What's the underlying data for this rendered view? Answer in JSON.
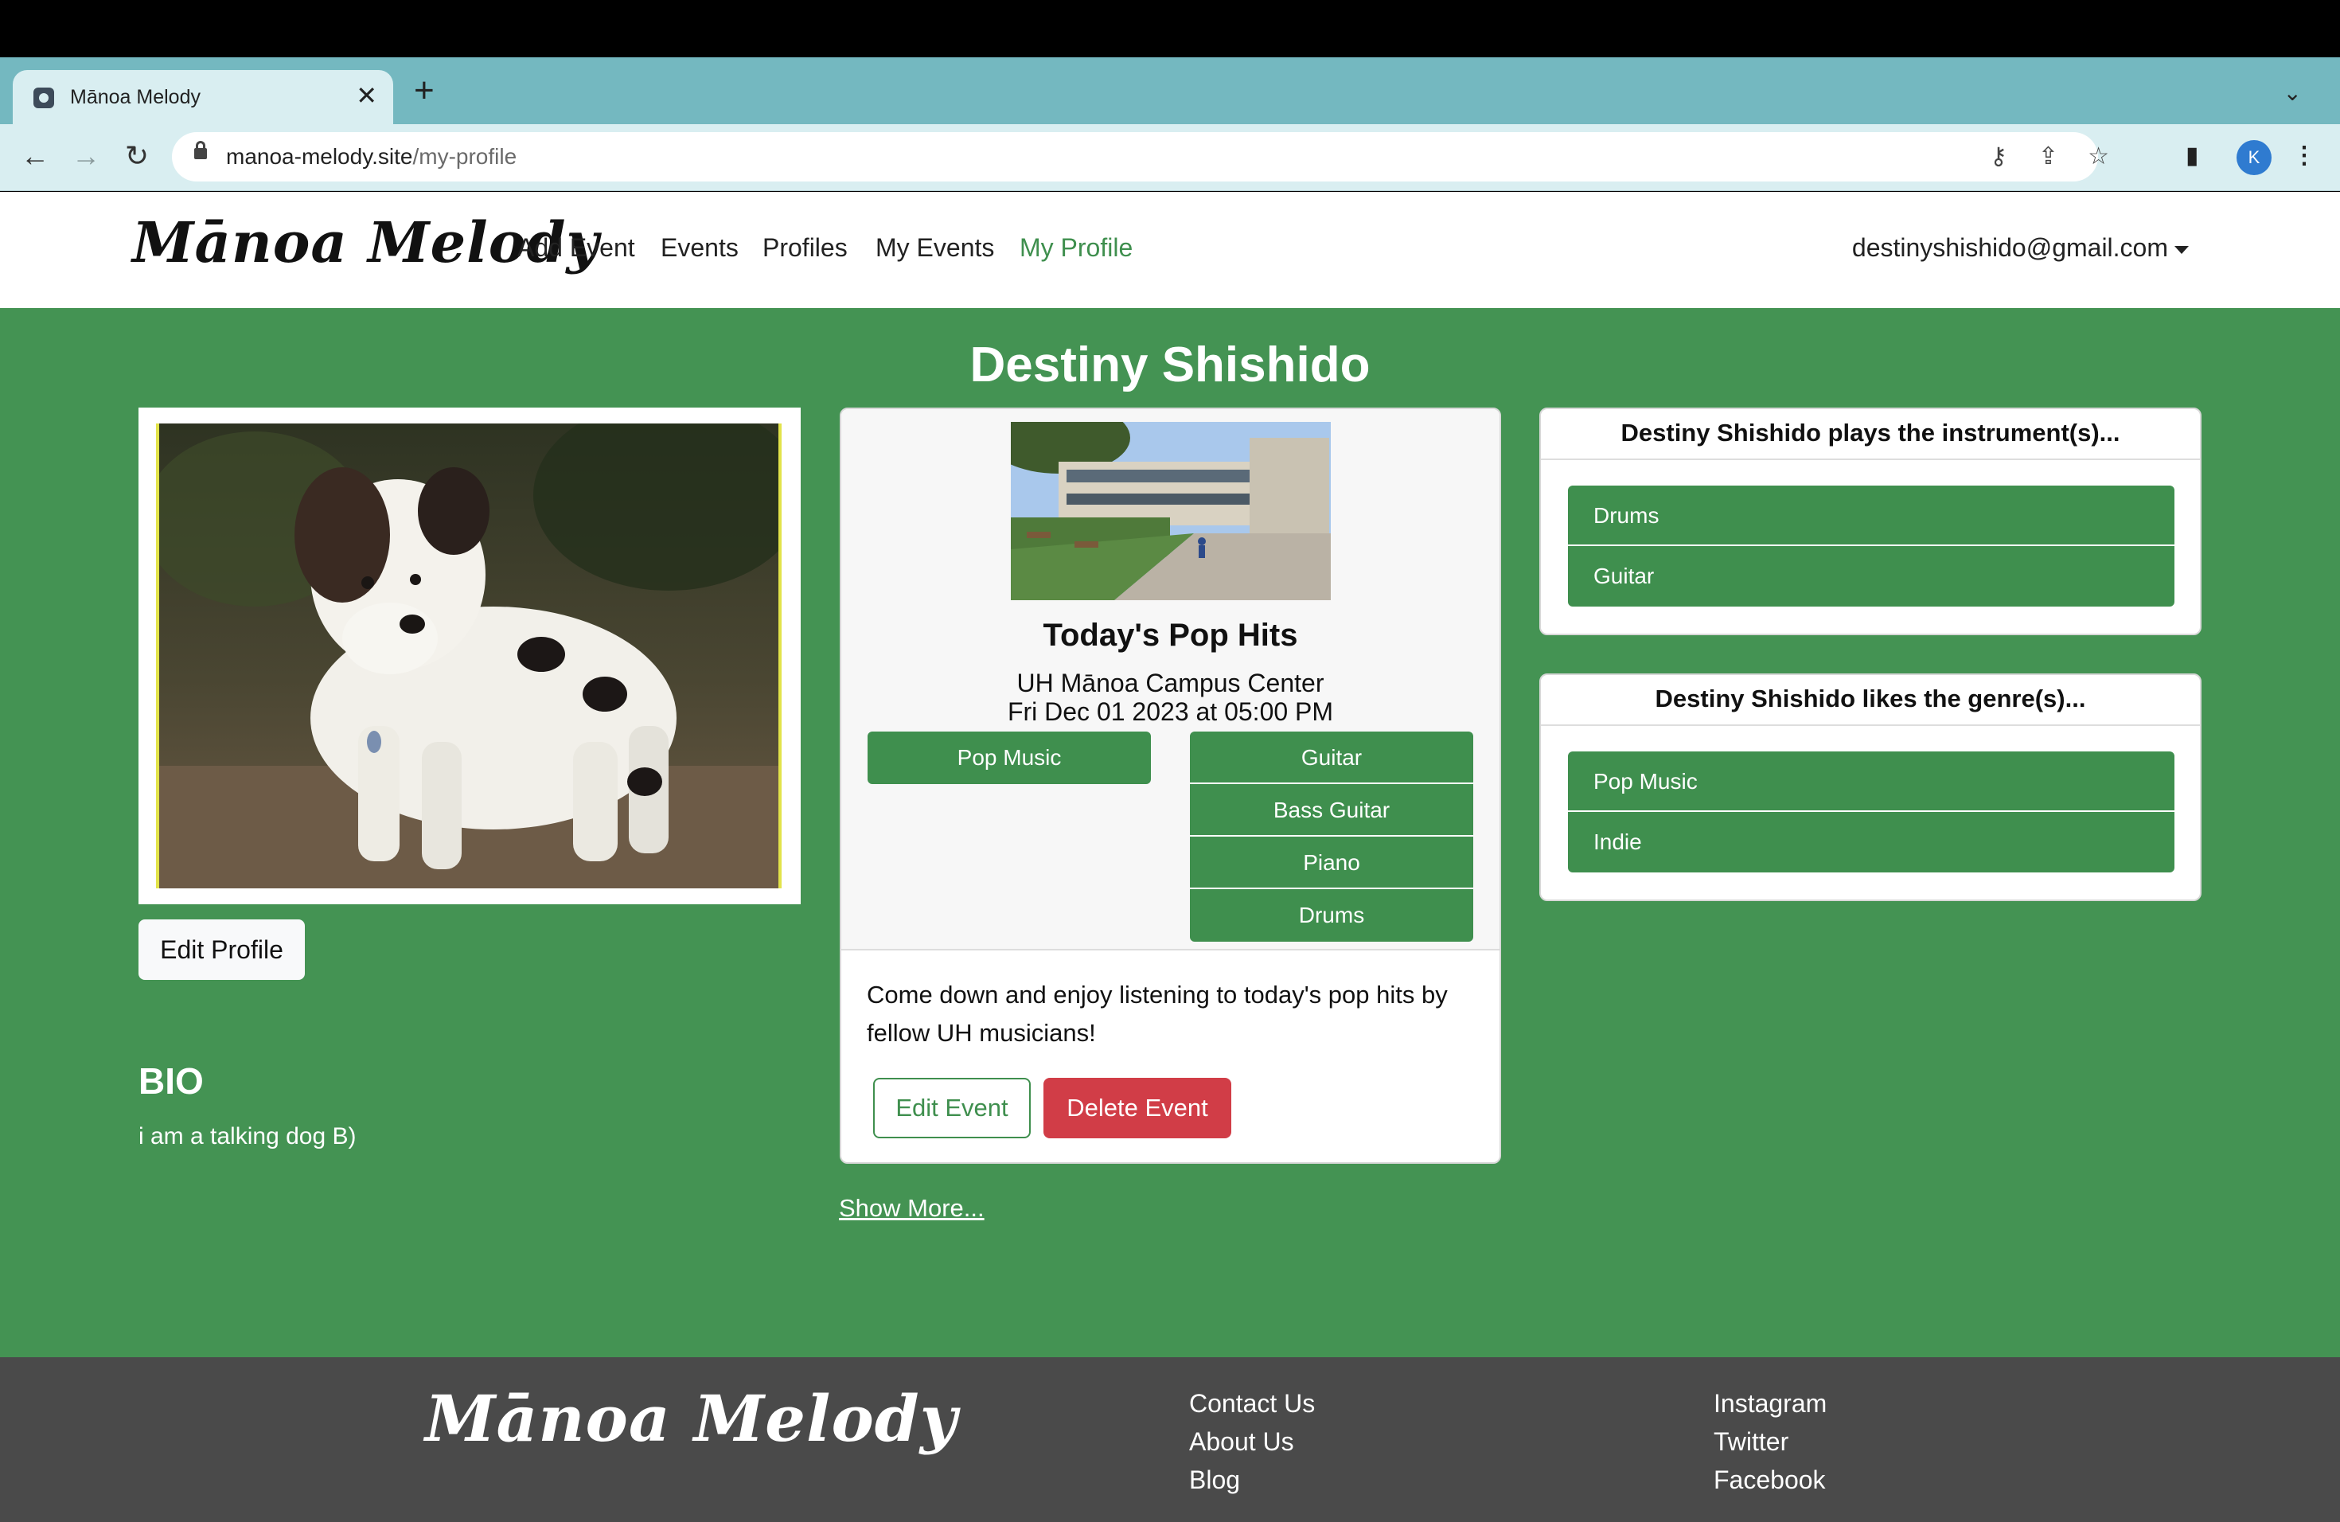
{
  "browser": {
    "tab_title": "Mānoa Melody",
    "tab_close": "✕",
    "new_tab": "+",
    "tab_menu": "⌄",
    "url_host": "manoa-melody.site",
    "url_path": "/my-profile",
    "profile_initial": "K",
    "icons": {
      "back": "←",
      "forward": "→",
      "reload": "↻",
      "key": "⚷",
      "share": "⇪",
      "star": "☆",
      "side_panel": "▮",
      "menu": "⋮"
    }
  },
  "nav": {
    "brand": "Mānoa Melody",
    "links": [
      "Add Event",
      "Events",
      "Profiles",
      "My Events",
      "My Profile"
    ],
    "active": "My Profile",
    "user_email": "destinyshishido@gmail.com"
  },
  "profile": {
    "name": "Destiny Shishido",
    "edit_label": "Edit Profile",
    "bio_title": "BIO",
    "bio": "i am a talking dog B)"
  },
  "event": {
    "title": "Today's Pop Hits",
    "venue": "UH Mānoa Campus Center",
    "date": "Fri Dec 01 2023 at 05:00 PM",
    "genres": [
      "Pop Music"
    ],
    "instruments": [
      "Guitar",
      "Bass Guitar",
      "Piano",
      "Drums"
    ],
    "description": "Come down and enjoy listening to today's pop hits by fellow UH musicians!",
    "edit_label": "Edit Event",
    "delete_label": "Delete Event"
  },
  "show_more": "Show More...",
  "instruments_card": {
    "heading": "Destiny Shishido plays the instrument(s)...",
    "items": [
      "Drums",
      "Guitar"
    ]
  },
  "genres_card": {
    "heading": "Destiny Shishido likes the genre(s)...",
    "items": [
      "Pop Music",
      "Indie"
    ]
  },
  "footer": {
    "brand": "Mānoa Melody",
    "col1": [
      "Contact Us",
      "About Us",
      "Blog"
    ],
    "col2": [
      "Instagram",
      "Twitter",
      "Facebook"
    ]
  },
  "colors": {
    "primary_green": "#449353",
    "button_green": "#3f8f4e",
    "danger_red": "#d13d47",
    "footer_gray": "#4a4a4a",
    "tabstrip_teal": "#74b8c0"
  }
}
